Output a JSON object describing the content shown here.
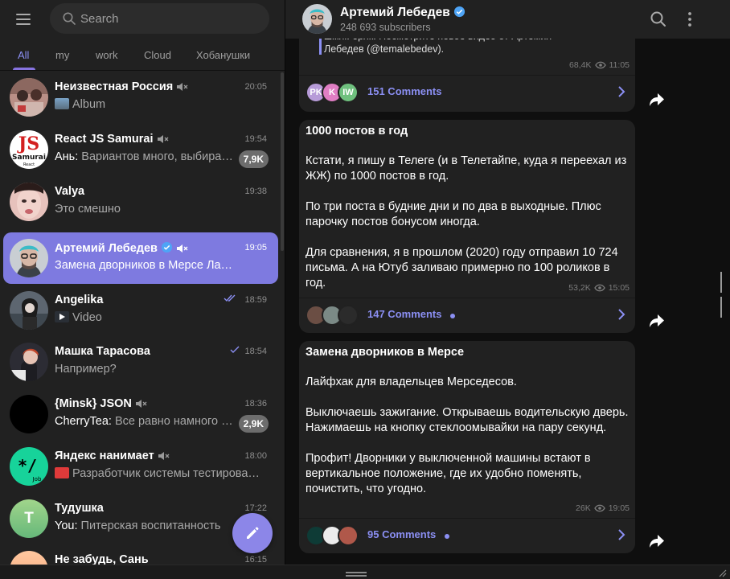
{
  "search": {
    "placeholder": "Search"
  },
  "tabs": [
    {
      "label": "All",
      "active": true
    },
    {
      "label": "my"
    },
    {
      "label": "work"
    },
    {
      "label": "Cloud"
    },
    {
      "label": "Хобанушки"
    }
  ],
  "chats": [
    {
      "name": "Неизвестная Россия",
      "time": "20:05",
      "preview": "Album",
      "muted": true
    },
    {
      "name": "React JS Samurai",
      "time": "19:54",
      "sender": "Ань",
      "preview": "Вариантов много, выбира…",
      "muted": true,
      "badge": "7,9K"
    },
    {
      "name": "Valya",
      "time": "19:38",
      "preview": "Это смешно"
    },
    {
      "name": "Артемий Лебедев",
      "time": "19:05",
      "preview": "Замена дворников в Мерсе Лайфхак…",
      "muted": true,
      "verified": true,
      "active": true
    },
    {
      "name": "Angelika",
      "time": "18:59",
      "preview": "Video",
      "read": "double"
    },
    {
      "name": "Машка Тарасова",
      "time": "18:54",
      "preview": "Например?",
      "read": "single"
    },
    {
      "name": "{Minsk} JSON",
      "time": "18:36",
      "sender": "CherryTea",
      "preview": "Все равно намного …",
      "muted": true,
      "badge": "2,9K"
    },
    {
      "name": "Яндекс нанимает",
      "time": "18:00",
      "preview": "Разработчик системы тестирова…",
      "muted": true
    },
    {
      "name": "Тудушка",
      "time": "17:22",
      "sender": "You",
      "preview": "Питерская воспитанность",
      "avatar_letter": "T"
    },
    {
      "name": "Не забудь, Сань",
      "time": "16:15",
      "preview": ""
    }
  ],
  "channel": {
    "title": "Артемий Лебедев",
    "subscribers": "248 693 subscribers"
  },
  "posts": [
    {
      "quote": "шмяк-бряк! Посмотрите новое видео от Артемия Лебедев (@temalebedev).",
      "views": "68,4K",
      "time": "11:05",
      "comments": "151 Comments",
      "commenters": [
        "PK",
        "K",
        "IW"
      ]
    },
    {
      "title": "1000 постов в год",
      "body": "Кстати, я пишу в Телеге (и в Телетайпе, куда я переехал из ЖЖ) по 1000 постов в год.\n\nПо три поста в будние дни и по два в выходные. Плюс парочку постов бонусом иногда.\n\nДля сравнения, я в прошлом (2020) году отправил 10 724 письма. А на Ютуб заливаю примерно по 100 роликов в год.",
      "views": "53,2K",
      "time": "15:05",
      "comments": "147 Comments"
    },
    {
      "title": "Замена дворников в Мерсе",
      "body": "Лайфхак для владельцев Мерседесов.\n\nВыключаешь зажигание. Открываешь водительскую дверь. Нажимаешь на кнопку стеклоомывайки на пару секунд.\n\nПрофит! Дворники у выключенной машины встают в вертикальное положение, где их удобно поменять, почистить, что угодно.",
      "views": "26K",
      "time": "19:05",
      "comments": "95 Comments"
    }
  ],
  "colors": {
    "accent": "#8774e1",
    "link": "#8b8ff3",
    "active_chat": "#7e7ae0",
    "panel": "#212121",
    "background": "#0f0f0f"
  }
}
